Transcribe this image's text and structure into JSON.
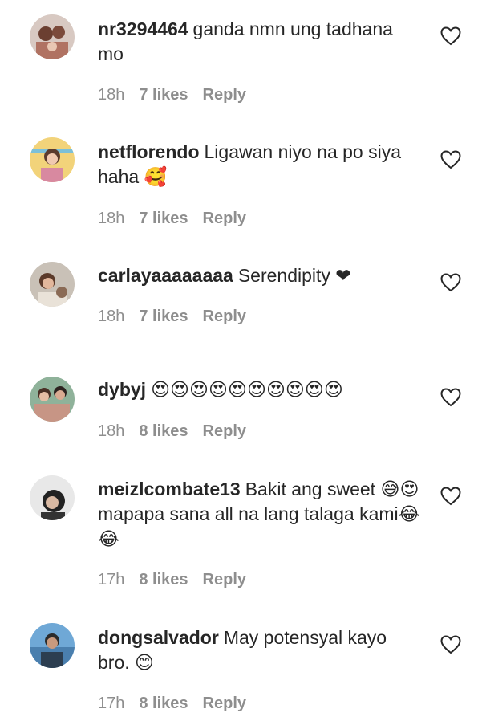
{
  "comments": [
    {
      "username": "nr3294464",
      "text": "ganda nmn ung tadhana mo",
      "time": "18h",
      "likes": "7 likes",
      "reply": "Reply",
      "avatar_colors": [
        "#d8c9c2",
        "#7b4a3b"
      ]
    },
    {
      "username": "netflorendo",
      "text": "Ligawan niyo na po siya haha 🥰",
      "time": "18h",
      "likes": "7 likes",
      "reply": "Reply",
      "avatar_colors": [
        "#f2d37a",
        "#c98b86"
      ]
    },
    {
      "username": "carlayaaaaaaaa",
      "text": "Serendipity ❤",
      "time": "18h",
      "likes": "7 likes",
      "reply": "Reply",
      "avatar_colors": [
        "#c9c1b7",
        "#8a6a55"
      ]
    },
    {
      "username": "dybyj",
      "text": "😍😍😍😍😍😍😍😍😍😍",
      "time": "18h",
      "likes": "8 likes",
      "reply": "Reply",
      "avatar_colors": [
        "#8fb29a",
        "#c79585"
      ]
    },
    {
      "username": "meizlcombate13",
      "text": "Bakit ang sweet 😅😍mapapa sana all na lang talaga kami😂😂",
      "time": "17h",
      "likes": "8 likes",
      "reply": "Reply",
      "avatar_colors": [
        "#e8e8e8",
        "#222222"
      ]
    },
    {
      "username": "dongsalvador",
      "text": "May potensyal kayo bro. 😊",
      "time": "17h",
      "likes": "8 likes",
      "reply": "Reply",
      "avatar_colors": [
        "#6fa8d6",
        "#2c3e50"
      ]
    }
  ],
  "icons": {
    "like": "heart-outline-icon"
  },
  "colors": {
    "text": "#262626",
    "meta": "#8e8e8e",
    "background": "#ffffff"
  }
}
